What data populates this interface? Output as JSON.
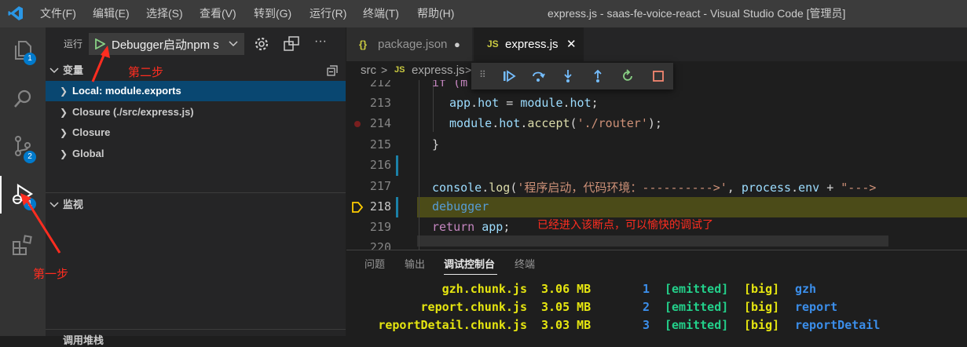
{
  "titlebar": {
    "menus": [
      "文件(F)",
      "编辑(E)",
      "选择(S)",
      "查看(V)",
      "转到(G)",
      "运行(R)",
      "终端(T)",
      "帮助(H)"
    ],
    "window_title": "express.js - saas-fe-voice-react - Visual Studio Code [管理员]"
  },
  "activity": {
    "explorer_badge": "1",
    "scm_badge": "2",
    "debug_badge": "1"
  },
  "sidebar": {
    "run_label": "运行",
    "config_select": "Debugger启动npm s",
    "variables_header": "变量",
    "variables": [
      "Local: module.exports",
      "Closure (./src/express.js)",
      "Closure",
      "Global"
    ],
    "watch_header": "监视",
    "callstack_header": "调用堆栈"
  },
  "tabs": [
    {
      "icon": "{}",
      "label": "package.json",
      "dirty": "●"
    },
    {
      "icon": "JS",
      "label": "express.js",
      "close": "✕"
    }
  ],
  "breadcrumb": {
    "folder": "src",
    "sep": ">",
    "icon": "JS",
    "file": "express.js",
    "sep2": ">"
  },
  "code": {
    "lines": [
      "212",
      "213",
      "214",
      "215",
      "216",
      "217",
      "218",
      "219",
      "220"
    ],
    "l212": "if (m",
    "l213_a": "app",
    "l213_b": ".",
    "l213_c": "hot",
    "l213_d": " = ",
    "l213_e": "module",
    "l213_f": ".",
    "l213_g": "hot",
    "l213_h": ";",
    "l214_a": "module",
    "l214_b": ".",
    "l214_c": "hot",
    "l214_d": ".",
    "l214_e": "accept",
    "l214_f": "(",
    "l214_g": "'./router'",
    "l214_h": ");",
    "l215": "}",
    "l217_a": "console",
    "l217_b": ".",
    "l217_c": "log",
    "l217_d": "(",
    "l217_e": "'程序启动，代码环境：---------->'",
    "l217_f": ", ",
    "l217_g": "process",
    "l217_h": ".",
    "l217_i": "env",
    "l217_j": " + ",
    "l217_k": "\"--->",
    "l218": "debugger",
    "l219_a": "return",
    "l219_b": " ",
    "l219_c": "app",
    "l219_d": ";"
  },
  "annotations": {
    "step2": "第二步",
    "step1": "第一步",
    "breakpoint_note": "已经进入该断点，可以愉快的调试了"
  },
  "panel": {
    "tabs": [
      "问题",
      "输出",
      "调试控制台",
      "终端"
    ],
    "rows": [
      {
        "file": "gzh.chunk.js",
        "size": "3.06 MB",
        "id": "1",
        "status": "[emitted]",
        "flag": "[big]",
        "name": "gzh"
      },
      {
        "file": "report.chunk.js",
        "size": "3.05 MB",
        "id": "2",
        "status": "[emitted]",
        "flag": "[big]",
        "name": "report"
      },
      {
        "file": "reportDetail.chunk.js",
        "size": "3.03 MB",
        "id": "3",
        "status": "[emitted]",
        "flag": "[big]",
        "name": "reportDetail"
      }
    ]
  },
  "colors": {
    "accent": "#007acc",
    "annotation": "#ff2d20",
    "debug_line": "#4b4b18"
  }
}
